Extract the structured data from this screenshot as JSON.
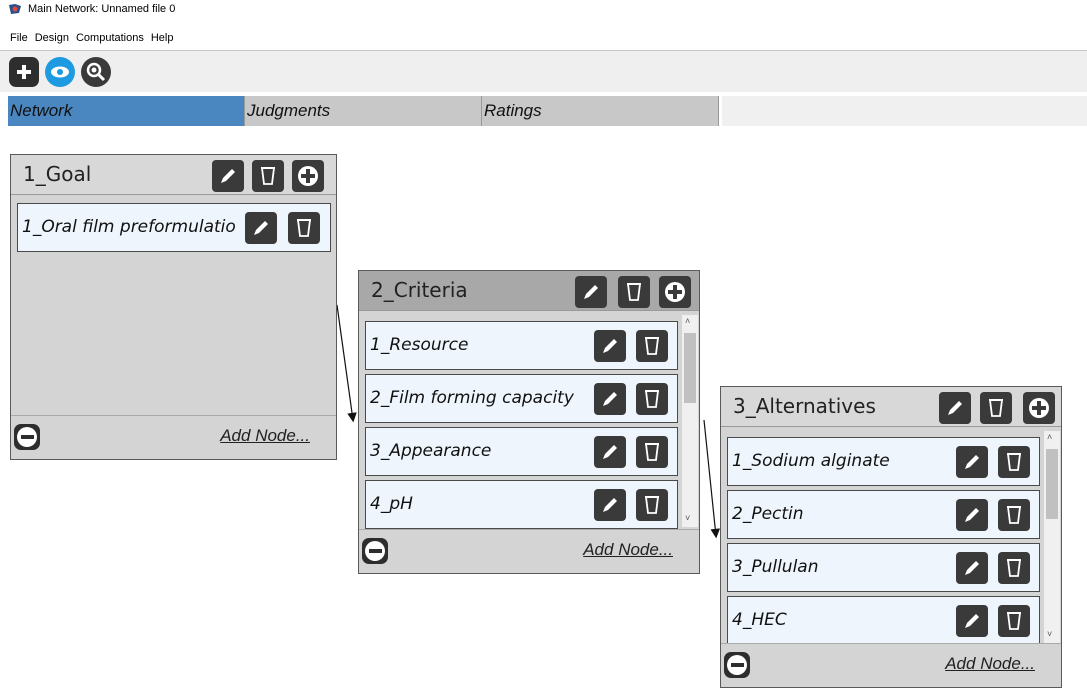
{
  "window": {
    "title": "Main Network: Unnamed file 0"
  },
  "menu": [
    "File",
    "Design",
    "Computations",
    "Help"
  ],
  "toolbar": {
    "buttons": [
      "add-icon",
      "eye-icon",
      "search-magnify-icon"
    ]
  },
  "tabs": [
    {
      "label": "Network",
      "active": true
    },
    {
      "label": "Judgments",
      "active": false
    },
    {
      "label": "Ratings",
      "active": false
    }
  ],
  "clusters": {
    "goal": {
      "title": "1_Goal",
      "nodes": [
        "1_Oral film preformulatio"
      ],
      "add_label": "Add Node..."
    },
    "criteria": {
      "title": "2_Criteria",
      "nodes": [
        "1_Resource",
        "2_Film forming capacity",
        "3_Appearance",
        "4_pH"
      ],
      "add_label": "Add Node..."
    },
    "alternatives": {
      "title": "3_Alternatives",
      "nodes": [
        "1_Sodium alginate",
        "2_Pectin",
        "3_Pullulan",
        "4_HEC"
      ],
      "add_label": "Add Node..."
    }
  },
  "colors": {
    "active_tab": "#4a87c1",
    "tab_bg": "#c8c8c8",
    "node_bg": "#eef5fc",
    "button_dark": "#3a3a3a"
  }
}
